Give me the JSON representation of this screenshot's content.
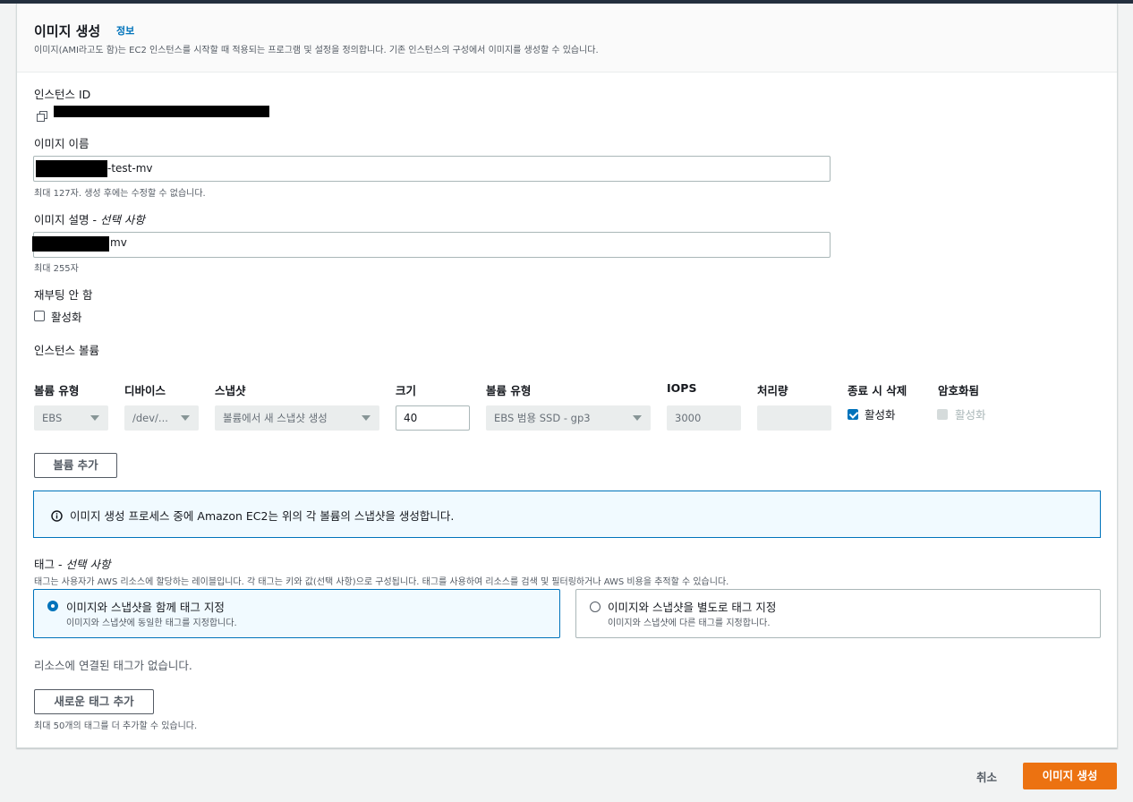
{
  "header": {
    "title": "이미지 생성",
    "info_link": "정보",
    "description": "이미지(AMI라고도 함)는 EC2 인스턴스를 시작할 때 적용되는 프로그램 및 설정을 정의합니다. 기존 인스턴스의 구성에서 이미지를 생성할 수 있습니다."
  },
  "instance": {
    "label": "인스턴스 ID"
  },
  "image_name": {
    "label": "이미지 이름",
    "value_suffix": "-test-mv",
    "hint": "최대 127자. 생성 후에는 수정할 수 없습니다."
  },
  "image_desc": {
    "label": "이미지 설명 - ",
    "label_optional": "선택 사항",
    "value_suffix": "mv",
    "hint": "최대 255자"
  },
  "no_reboot": {
    "label": "재부팅 안 함",
    "checkbox_label": "활성화",
    "checked": false
  },
  "volumes": {
    "title": "인스턴스 볼륨",
    "columns": [
      "볼륨 유형",
      "디바이스",
      "스냅샷",
      "크기",
      "볼륨 유형",
      "IOPS",
      "처리량",
      "종료 시 삭제",
      "암호화됨"
    ],
    "row": {
      "volume_type": "EBS",
      "device": "/dev/...",
      "snapshot": "볼륨에서 새 스냅샷 생성",
      "size": "40",
      "ebs_type": "EBS 범용 SSD - gp3",
      "iops": "3000",
      "throughput": "",
      "delete_on_termination": "활성화",
      "encrypted": "활성화"
    },
    "add_button": "볼륨 추가"
  },
  "alert": {
    "text": "이미지 생성 프로세스 중에 Amazon EC2는 위의 각 볼륨의 스냅샷을 생성합니다."
  },
  "tags": {
    "label": "태그 - ",
    "label_optional": "선택 사항",
    "description": "태그는 사용자가 AWS 리소스에 할당하는 레이블입니다. 각 태그는 키와 값(선택 사항)으로 구성됩니다. 태그를 사용하여 리소스를 검색 및 필터링하거나 AWS 비용을 추적할 수 있습니다.",
    "option_together": {
      "title": "이미지와 스냅샷을 함께 태그 지정",
      "desc": "이미지와 스냅샷에 동일한 태그를 지정합니다."
    },
    "option_separate": {
      "title": "이미지와 스냅샷을 별도로 태그 지정",
      "desc": "이미지와 스냅샷에 다른 태그를 지정합니다."
    },
    "empty": "리소스에 연결된 태그가 없습니다.",
    "add_button": "새로운 태그 추가",
    "limit_hint": "최대 50개의 태그를 더 추가할 수 있습니다."
  },
  "footer": {
    "cancel": "취소",
    "create": "이미지 생성"
  },
  "colors": {
    "primary": "#ec7211",
    "link": "#0073bb"
  }
}
